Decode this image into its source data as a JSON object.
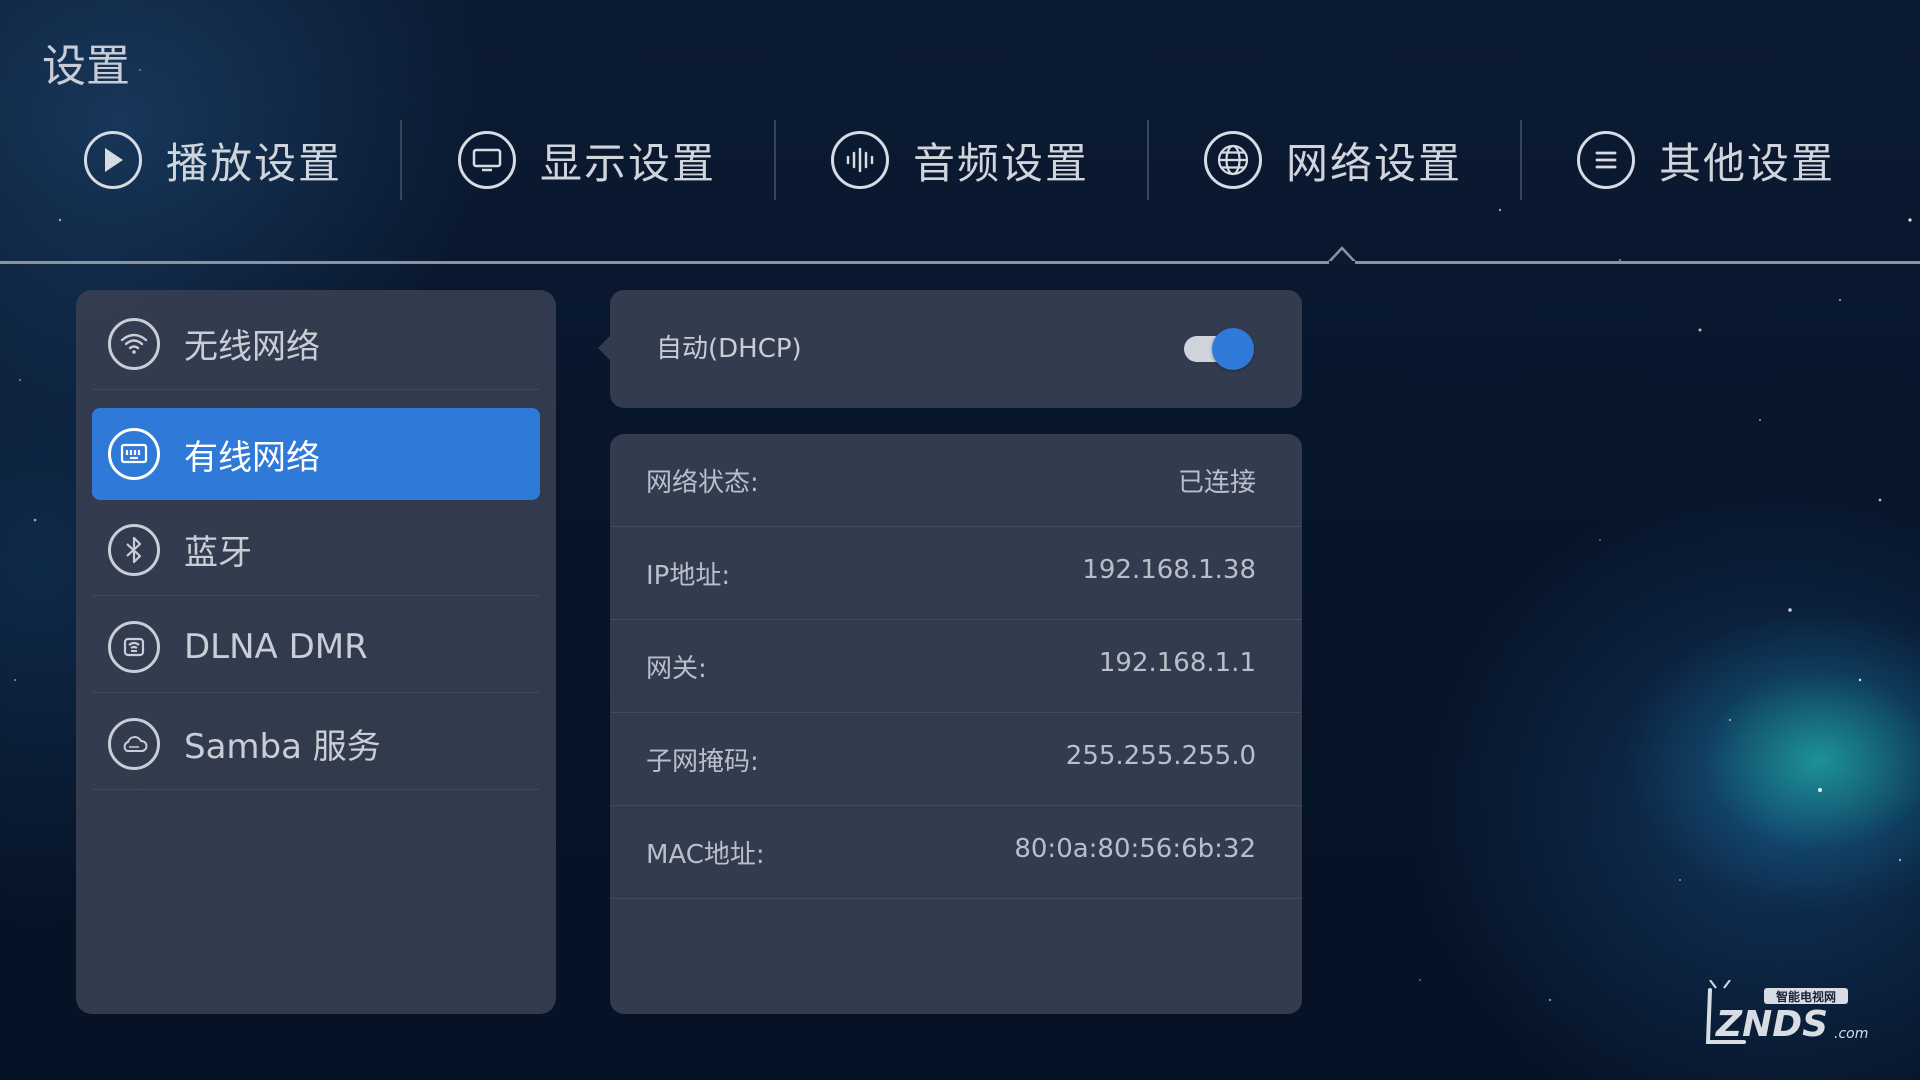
{
  "page": {
    "title": "设置"
  },
  "tabs": [
    {
      "label": "播放设置",
      "icon": "play-icon"
    },
    {
      "label": "显示设置",
      "icon": "monitor-icon"
    },
    {
      "label": "音频设置",
      "icon": "audio-wave-icon"
    },
    {
      "label": "网络设置",
      "icon": "globe-icon",
      "selected": true
    },
    {
      "label": "其他设置",
      "icon": "menu-icon"
    }
  ],
  "sidebar": {
    "items": [
      {
        "label": "无线网络",
        "icon": "wifi-icon"
      },
      {
        "label": "有线网络",
        "icon": "ethernet-icon",
        "selected": true
      },
      {
        "label": "蓝牙",
        "icon": "bluetooth-icon"
      },
      {
        "label": "DLNA DMR",
        "icon": "dlna-icon"
      },
      {
        "label": "Samba 服务",
        "icon": "samba-icon"
      }
    ]
  },
  "dhcp": {
    "label": "自动(DHCP)",
    "enabled": true
  },
  "info": [
    {
      "key": "网络状态:",
      "value": "已连接"
    },
    {
      "key": "IP地址:",
      "value": "192.168.1.38"
    },
    {
      "key": "网关:",
      "value": "192.168.1.1"
    },
    {
      "key": "子网掩码:",
      "value": "255.255.255.0"
    },
    {
      "key": "MAC地址:",
      "value": "80:0a:80:56:6b:32"
    }
  ],
  "watermark": {
    "top": "智能电视网",
    "main": "ZNDS",
    "suffix": ".com"
  },
  "colors": {
    "accent": "#2f7ad8",
    "panel": "#363e50",
    "background": "#07152a"
  }
}
